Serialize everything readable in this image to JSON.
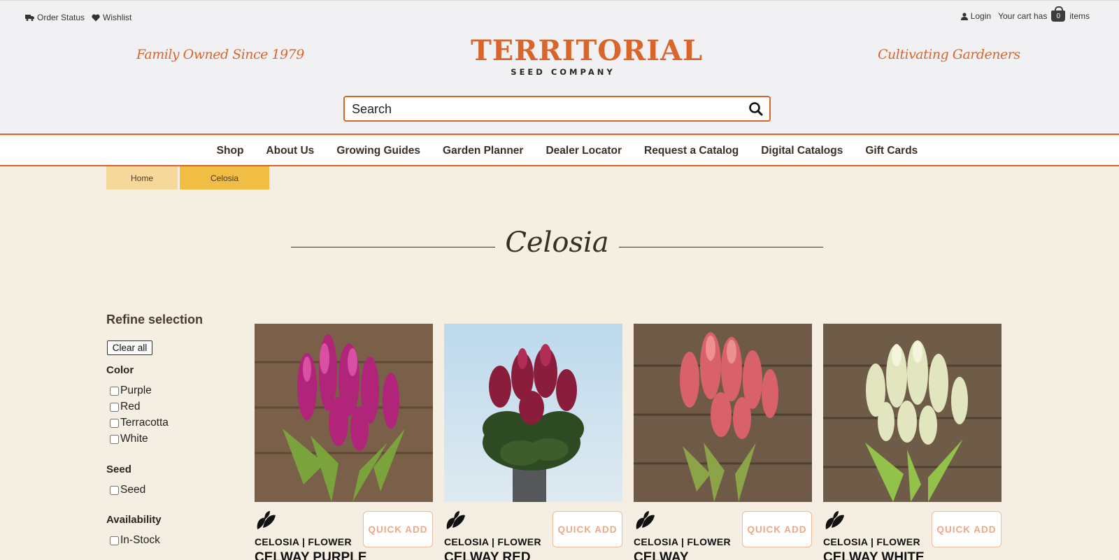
{
  "header": {
    "util_left": [
      {
        "label": "Order Status",
        "icon": "truck-icon"
      },
      {
        "label": "Wishlist",
        "icon": "heart-icon"
      }
    ],
    "login_label": "Login",
    "cart_prefix": "Your cart has",
    "cart_count": "0",
    "cart_suffix": "items",
    "tagline_left": "Family Owned Since 1979",
    "tagline_right": "Cultivating Gardeners",
    "logo_main": "TERRITORIAL",
    "logo_sub": "SEED COMPANY"
  },
  "search": {
    "placeholder": "Search"
  },
  "nav": [
    "Shop",
    "About Us",
    "Growing Guides",
    "Garden Planner",
    "Dealer Locator",
    "Request a Catalog",
    "Digital Catalogs",
    "Gift Cards"
  ],
  "breadcrumb": {
    "home": "Home",
    "current": "Celosia"
  },
  "page_title": "Celosia",
  "filters": {
    "title": "Refine selection",
    "clear_label": "Clear all",
    "color_title": "Color",
    "colors": [
      "Purple",
      "Red",
      "Terracotta",
      "White"
    ],
    "seed_title": "Seed",
    "seed_options": [
      "Seed"
    ],
    "availability_title": "Availability",
    "availability_options": [
      "In-Stock"
    ]
  },
  "products": [
    {
      "category": "CELOSIA | FLOWER",
      "name": "CELWAY PURPLE",
      "quick_add": "QUICK ADD"
    },
    {
      "category": "CELOSIA | FLOWER",
      "name": "CELWAY RED",
      "quick_add": "QUICK ADD"
    },
    {
      "category": "CELOSIA | FLOWER",
      "name": "CELWAY",
      "quick_add": "QUICK ADD"
    },
    {
      "category": "CELOSIA | FLOWER",
      "name": "CELWAY WHITE",
      "quick_add": "QUICK ADD"
    }
  ],
  "colors": {
    "brand_orange": "#d9652b",
    "crumb_home": "#f7d89b",
    "crumb_current": "#f0bd45",
    "background": "#f4efe2"
  }
}
